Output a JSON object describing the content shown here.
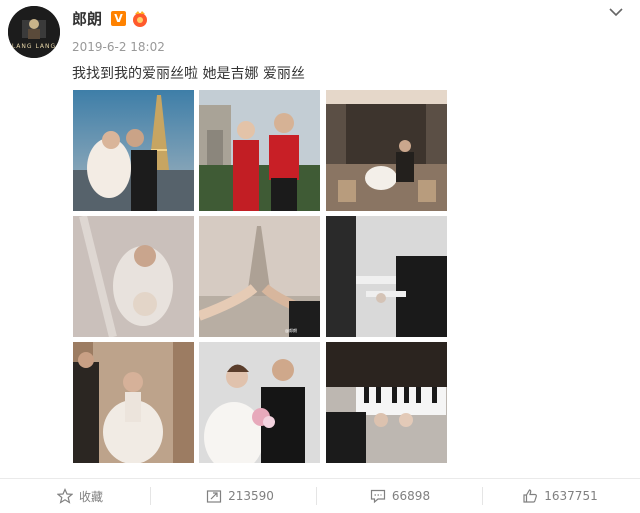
{
  "post": {
    "author_name": "郎朗",
    "avatar_text": "LANG LANG",
    "timestamp": "2019-6-2 18:02",
    "content": "我找到我的爱丽丝啦 她是吉娜 爱丽丝",
    "verified_badge": "V",
    "photo_watermark": "@郎朗"
  },
  "actions": {
    "favorite_label": "收藏",
    "repost_count": "213590",
    "comment_count": "66898",
    "like_count": "1637751"
  },
  "photos": [
    {
      "name": "eiffel-tower-couple"
    },
    {
      "name": "arc-de-triomphe-qipao"
    },
    {
      "name": "paris-cafe-couple"
    },
    {
      "name": "veil-closeup"
    },
    {
      "name": "holding-hands-eiffel"
    },
    {
      "name": "piano-hands-bw"
    },
    {
      "name": "door-portrait"
    },
    {
      "name": "bouquet-portrait"
    },
    {
      "name": "piano-keys-four-hands"
    }
  ],
  "colors": {
    "brand_orange": "#ff8200",
    "text": "#333333",
    "muted": "#999999"
  }
}
